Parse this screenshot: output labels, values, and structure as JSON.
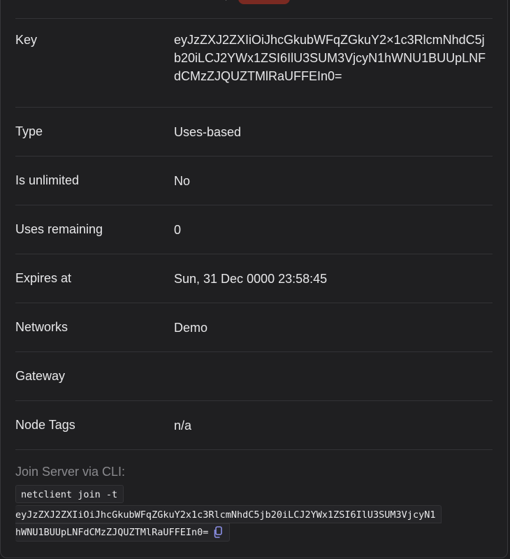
{
  "details": {
    "rows": [
      {
        "label": "Key",
        "value": "eyJzZXJ2ZXIiOiJhcGkubWFqZGkuY2×1c3RlcmNhdC5jb20iLCJ2YWx1ZSI6IlU3SUM3VjcyN1hWNU1BUUpLNFdCMzZJQUZTMlRaUFFEIn0="
      },
      {
        "label": "Type",
        "value": "Uses-based"
      },
      {
        "label": "Is unlimited",
        "value": "No"
      },
      {
        "label": "Uses remaining",
        "value": "0"
      },
      {
        "label": "Expires at",
        "value": "Sun, 31 Dec 0000 23:58:45"
      },
      {
        "label": "Networks",
        "value": "Demo"
      },
      {
        "label": "Gateway",
        "value": ""
      },
      {
        "label": "Node Tags",
        "value": "n/a"
      }
    ]
  },
  "cli": {
    "title": "Join Server via CLI:",
    "command_line1": "netclient join -t",
    "command_line2": "eyJzZXJ2ZXIiOiJhcGkubWFqZGkuY2x1c3RlcmNhdC5jb20iLCJ2YWx1ZSI6IlU3SUM3VjcyN1",
    "command_line3": "hWNU1BUUpLNFdCMzZJQUZTMlRaUFFEIn0=",
    "copy_icon": "copy-icon"
  },
  "colors": {
    "background": "#1f1f21",
    "accent_pill": "#7a2a22",
    "muted_text": "#8a8a8e"
  }
}
